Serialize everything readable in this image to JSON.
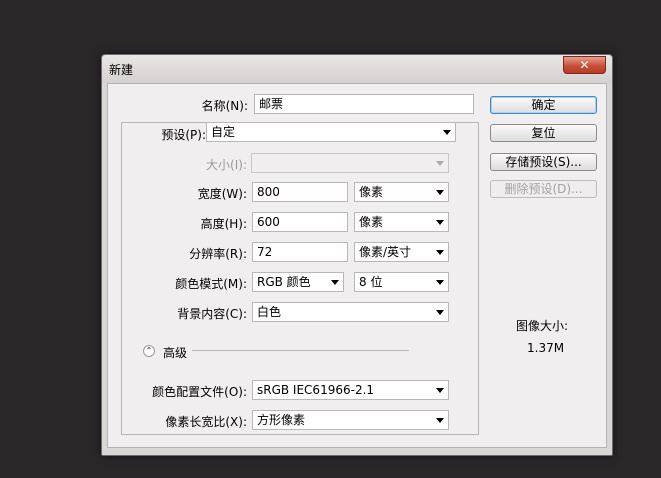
{
  "dialog": {
    "title": "新建",
    "close_glyph": "✕"
  },
  "name": {
    "label": "名称(N):",
    "value": "邮票"
  },
  "preset": {
    "label": "预设(P):",
    "value": "自定"
  },
  "size": {
    "label": "大小(I):",
    "value": ""
  },
  "width": {
    "label": "宽度(W):",
    "value": "800",
    "unit": "像素"
  },
  "height": {
    "label": "高度(H):",
    "value": "600",
    "unit": "像素"
  },
  "resolution": {
    "label": "分辨率(R):",
    "value": "72",
    "unit": "像素/英寸"
  },
  "color_mode": {
    "label": "颜色模式(M):",
    "value": "RGB 颜色",
    "bit_depth": "8 位"
  },
  "background": {
    "label": "背景内容(C):",
    "value": "白色"
  },
  "advanced": {
    "label": "高级",
    "toggle_glyph": "⌃"
  },
  "color_profile": {
    "label": "颜色配置文件(O):",
    "value": "sRGB IEC61966-2.1"
  },
  "pixel_aspect": {
    "label": "像素长宽比(X):",
    "value": "方形像素"
  },
  "buttons": {
    "ok": "确定",
    "reset": "复位",
    "save_preset": "存储预设(S)...",
    "delete_preset": "删除预设(D)..."
  },
  "image_size": {
    "label": "图像大小:",
    "value": "1.37M"
  },
  "colors": {
    "background": "#2a2729",
    "dialog": "#f0eeef",
    "close_button": "#c75039",
    "primary_border": "#3d8ad0"
  },
  "icons": {
    "close": "close-icon",
    "dropdown": "chevron-down-icon",
    "advanced": "chevron-up-icon"
  }
}
